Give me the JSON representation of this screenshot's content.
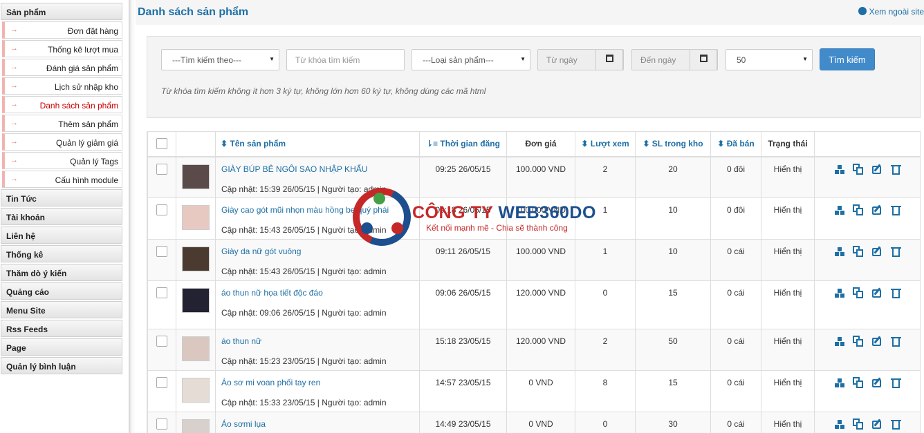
{
  "sidebar": {
    "groups": [
      {
        "label": "Sản phẩm"
      },
      {
        "label": "Tin Tức"
      },
      {
        "label": "Tài khoản"
      },
      {
        "label": "Liên hệ"
      },
      {
        "label": "Thống kê"
      },
      {
        "label": "Thăm dò ý kiến"
      },
      {
        "label": "Quảng cáo"
      },
      {
        "label": "Menu Site"
      },
      {
        "label": "Rss Feeds"
      },
      {
        "label": "Page"
      },
      {
        "label": "Quản lý bình luận"
      }
    ],
    "items": [
      {
        "label": "Đơn đặt hàng"
      },
      {
        "label": "Thống kê lượt mua"
      },
      {
        "label": "Đánh giá sản phẩm"
      },
      {
        "label": "Lịch sử nhập kho"
      },
      {
        "label": "Danh sách sản phẩm",
        "active": true
      },
      {
        "label": "Thêm sản phẩm"
      },
      {
        "label": "Quản lý giảm giá"
      },
      {
        "label": "Quản lý Tags"
      },
      {
        "label": "Cấu hình module"
      }
    ],
    "arrow_icon": "→"
  },
  "header": {
    "title": "Danh sách sản phẩm",
    "site_link": "Xem ngoài site"
  },
  "search": {
    "search_by": "---Tìm kiếm theo---",
    "keyword_placeholder": "Từ khóa tìm kiếm",
    "category": "---Loại sản phẩm---",
    "from_date_placeholder": "Từ ngày",
    "to_date_placeholder": "Đến ngày",
    "per_page": "50",
    "button": "Tìm kiếm",
    "hint": "Từ khóa tìm kiếm không ít hơn 3 ký tự, không lớn hơn 60 ký tự, không dùng các mã html"
  },
  "table": {
    "headers": {
      "name": "Tên sản phẩm",
      "time": "Thời gian đăng",
      "price": "Đơn giá",
      "views": "Lượt xem",
      "stock": "SL trong kho",
      "sold": "Đã bán",
      "status": "Trạng thái"
    },
    "rows": [
      {
        "name": "GIÀY BÚP BÊ NGÔI SAO NHẬP KHẨU",
        "meta": "Cập nhật: 15:39 26/05/15 | Người tạo: admin",
        "time": "09:25 26/05/15",
        "price": "100.000 VND",
        "views": "2",
        "stock": "20",
        "sold": "0 đôi",
        "status": "Hiển thị"
      },
      {
        "name": "Giày cao gót mũi nhọn màu hồng be quý phái",
        "meta": "Cập nhật: 15:43 26/05/15 | Người tạo: admin",
        "time": "09:18 26/05/15",
        "price": "100.000 VND",
        "views": "1",
        "stock": "10",
        "sold": "0 đôi",
        "status": "Hiển thị"
      },
      {
        "name": "Giày da nữ gót vuông",
        "meta": "Cập nhật: 15:43 26/05/15 | Người tạo: admin",
        "time": "09:11 26/05/15",
        "price": "100.000 VND",
        "views": "1",
        "stock": "10",
        "sold": "0 cái",
        "status": "Hiển thị"
      },
      {
        "name": "áo thun nữ họa tiết độc đáo",
        "meta": "Cập nhật: 09:06 26/05/15 | Người tạo: admin",
        "time": "09:06 26/05/15",
        "price": "120.000 VND",
        "views": "0",
        "stock": "15",
        "sold": "0 cái",
        "status": "Hiển thị"
      },
      {
        "name": "áo thun nữ",
        "meta": "Cập nhật: 15:23 23/05/15 | Người tạo: admin",
        "time": "15:18 23/05/15",
        "price": "120.000 VND",
        "views": "2",
        "stock": "50",
        "sold": "0 cái",
        "status": "Hiển thị"
      },
      {
        "name": "Áo sơ mi voan phối tay ren",
        "meta": "Cập nhật: 15:33 23/05/15 | Người tạo: admin",
        "time": "14:57 23/05/15",
        "price": "0 VND",
        "views": "8",
        "stock": "15",
        "sold": "0 cái",
        "status": "Hiển thị"
      },
      {
        "name": "Áo sơmi lụa",
        "meta": "",
        "time": "14:49 23/05/15",
        "price": "0 VND",
        "views": "0",
        "stock": "30",
        "sold": "0 cái",
        "status": "Hiển thị"
      }
    ],
    "thumb_colors": [
      "#5a4a4a",
      "#e8c9c2",
      "#4a3a30",
      "#222233",
      "#d9c7c0",
      "#e6dcd6",
      "#d8d0cc"
    ]
  },
  "watermark": {
    "title_red": "CÔNG TY ",
    "title_blue": "WEB360DO",
    "slogan": "Kết nối mạnh mẽ - Chia sẽ thành công"
  },
  "colors": {
    "link": "#1d6fa5",
    "active": "#cc0000",
    "button": "#428bca"
  }
}
